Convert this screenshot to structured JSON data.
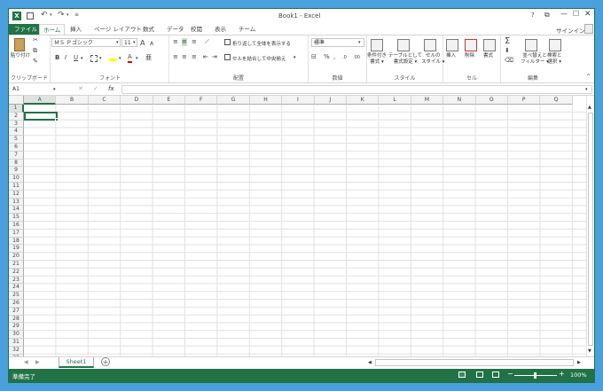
{
  "title": {
    "book": "Book1 - Excel",
    "help": "?",
    "sign_in": "サインイン"
  },
  "tabs": [
    "ファイル",
    "ホーム",
    "挿入",
    "ページ レイアウト",
    "数式",
    "データ",
    "校閲",
    "表示",
    "チーム"
  ],
  "clipboard": {
    "paste": "貼り付け",
    "label": "クリップボード"
  },
  "font": {
    "name": "ＭＳ Ｐゴシック",
    "size": "11",
    "bold": "B",
    "italic": "I",
    "underline": "U",
    "grow": "A",
    "shrink": "A",
    "color_letter": "A",
    "label": "フォント"
  },
  "alignment": {
    "wrap": "折り返して全体を表示する",
    "merge": "セルを結合して中央揃え",
    "label": "配置"
  },
  "number": {
    "format": "標準",
    "percent": "%",
    "comma": ",",
    "label": "数値"
  },
  "styles": {
    "conditional": "条件付き\n書式",
    "table": "テーブルとして\n書式設定",
    "cell": "セルの\nスタイル",
    "label": "スタイル"
  },
  "cells": {
    "insert": "挿入",
    "delete": "削除",
    "format": "書式",
    "label": "セル"
  },
  "editing": {
    "sort": "並べ替えと\nフィルター",
    "find": "検索と\n選択",
    "label": "編集",
    "sigma": "Σ"
  },
  "formula_bar": {
    "name_box": "A1",
    "fx": "fx",
    "value": ""
  },
  "columns": [
    "A",
    "B",
    "C",
    "D",
    "E",
    "F",
    "G",
    "H",
    "I",
    "J",
    "K",
    "L",
    "M",
    "N",
    "O",
    "P",
    "Q"
  ],
  "rows": [
    "1",
    "2",
    "3",
    "4",
    "5",
    "6",
    "7",
    "8",
    "9",
    "10",
    "11",
    "12",
    "13",
    "14",
    "15",
    "16",
    "17",
    "18",
    "19",
    "20",
    "21",
    "22",
    "23",
    "24",
    "25",
    "26",
    "27",
    "28",
    "29",
    "30",
    "31",
    "32",
    "33",
    "34",
    "35"
  ],
  "sheets": [
    "Sheet1"
  ],
  "status": {
    "ready": "準備完了",
    "zoom": "100%"
  },
  "colors": {
    "accent": "#217346",
    "background": "#4aa0dd"
  }
}
